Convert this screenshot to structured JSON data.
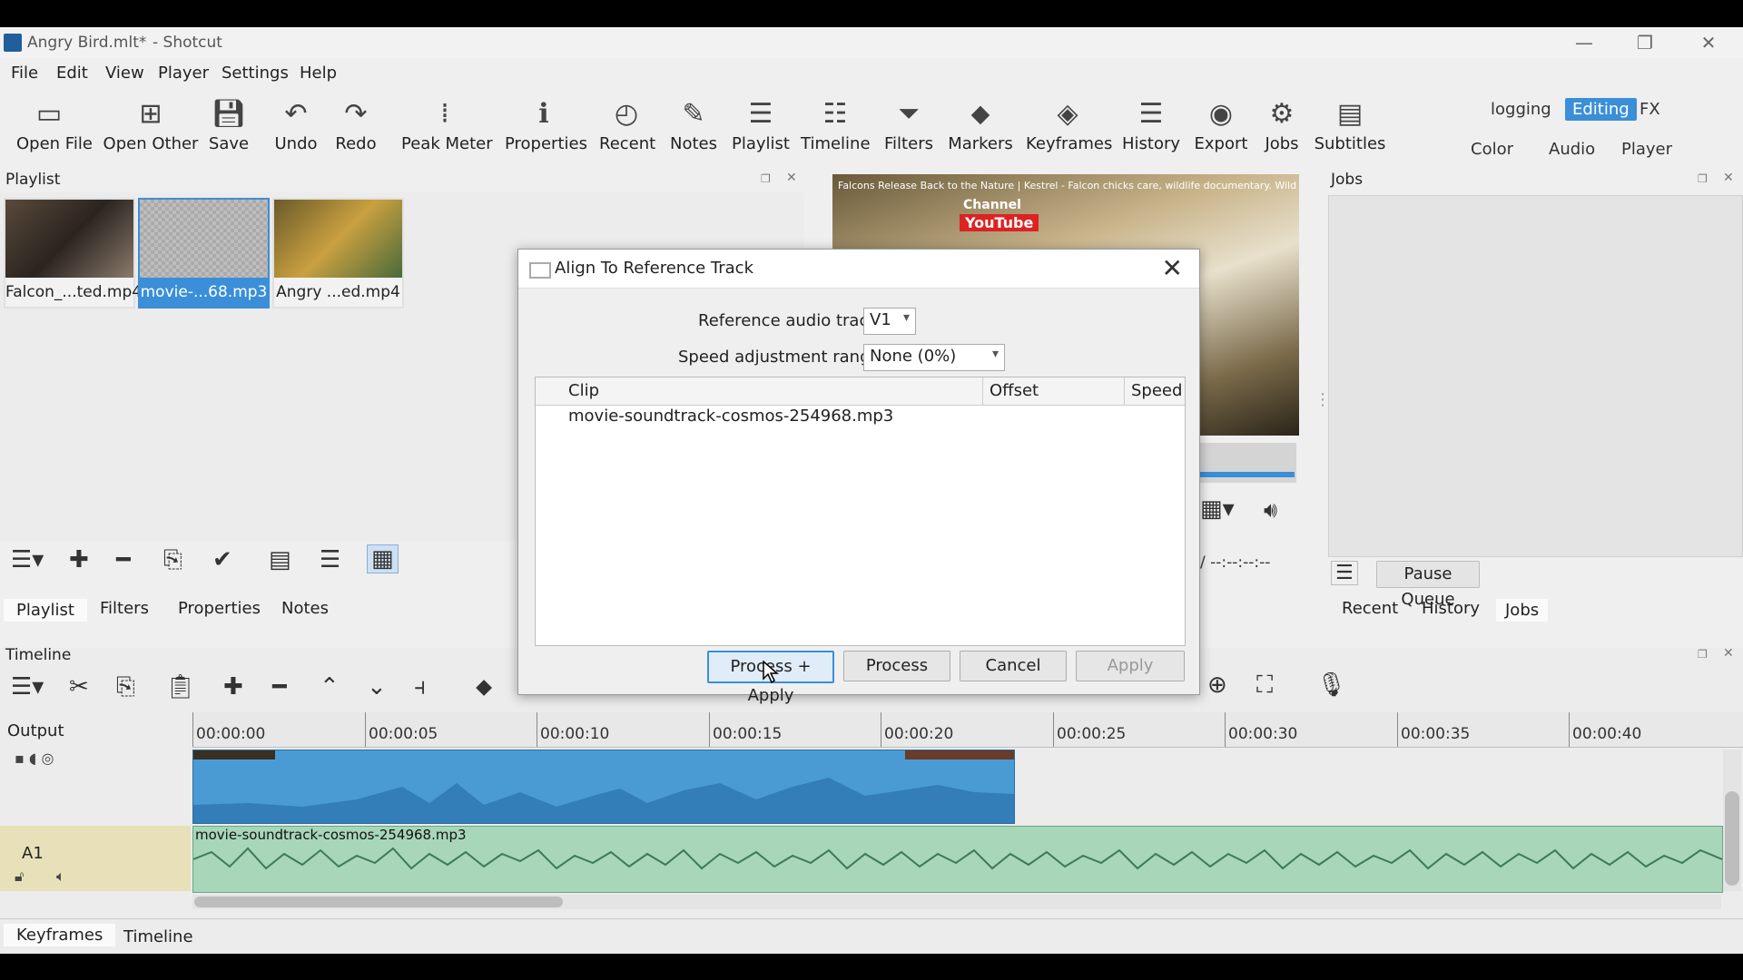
{
  "window": {
    "document_title": "Angry Bird.mlt*",
    "app_separator": "- Shotcut",
    "minimize": "—",
    "restore": "❐",
    "close": "✕"
  },
  "menu": [
    "File",
    "Edit",
    "View",
    "Player",
    "Settings",
    "Help"
  ],
  "toolbar": [
    {
      "label": "Open File",
      "icon": "open-file-icon"
    },
    {
      "label": "Open Other",
      "icon": "open-other-icon"
    },
    {
      "label": "Save",
      "icon": "save-icon"
    },
    {
      "label": "Undo",
      "icon": "undo-icon"
    },
    {
      "label": "Redo",
      "icon": "redo-icon"
    },
    {
      "label": "Peak Meter",
      "icon": "peak-meter-icon"
    },
    {
      "label": "Properties",
      "icon": "properties-icon"
    },
    {
      "label": "Recent",
      "icon": "recent-icon"
    },
    {
      "label": "Notes",
      "icon": "notes-icon"
    },
    {
      "label": "Playlist",
      "icon": "playlist-icon"
    },
    {
      "label": "Timeline",
      "icon": "timeline-icon"
    },
    {
      "label": "Filters",
      "icon": "filters-icon"
    },
    {
      "label": "Markers",
      "icon": "markers-icon"
    },
    {
      "label": "Keyframes",
      "icon": "keyframes-icon"
    },
    {
      "label": "History",
      "icon": "history-icon"
    },
    {
      "label": "Export",
      "icon": "export-icon"
    },
    {
      "label": "Jobs",
      "icon": "jobs-icon"
    },
    {
      "label": "Subtitles",
      "icon": "subtitles-icon"
    }
  ],
  "workspaces": {
    "logging": "logging",
    "editing": "Editing",
    "fx": "FX",
    "color": "Color",
    "audio": "Audio",
    "player": "Player"
  },
  "playlist": {
    "title": "Playlist",
    "items": [
      {
        "caption": "Falcon_...ted.mp4"
      },
      {
        "caption": "movie-...68.mp3"
      },
      {
        "caption": "Angry ...ed.mp4"
      }
    ],
    "tabs": [
      "Playlist",
      "Filters",
      "Properties",
      "Notes"
    ]
  },
  "viewer": {
    "caption": "Falcons Release Back to the Nature | Kestrel - Falcon chicks care, wildlife documentary. Wild birds",
    "channel": "Channel",
    "brand": "YouTube",
    "timecode": "/  --:--:--:--"
  },
  "jobs": {
    "title": "Jobs",
    "pause_queue": "Pause Queue",
    "tabs": [
      "Recent",
      "History",
      "Jobs"
    ]
  },
  "timeline": {
    "title": "Timeline",
    "output_label": "Output",
    "track_a1": "A1",
    "ruler": [
      "00:00:00",
      "00:00:05",
      "00:00:10",
      "00:00:15",
      "00:00:20",
      "00:00:25",
      "00:00:30",
      "00:00:35",
      "00:00:40"
    ],
    "a1_clip": "movie-soundtrack-cosmos-254968.mp3"
  },
  "bottom_tabs": [
    "Keyframes",
    "Timeline"
  ],
  "dialog": {
    "title": "Align To Reference Track",
    "ref_label": "Reference audio track",
    "ref_value": "V1",
    "speed_label": "Speed adjustment range",
    "speed_value": "None (0%)",
    "columns": [
      "Clip",
      "Offset",
      "Speed"
    ],
    "rows": [
      {
        "clip": "movie-soundtrack-cosmos-254968.mp3",
        "offset": "",
        "speed": ""
      }
    ],
    "buttons": {
      "process_apply": "Process + Apply",
      "process": "Process",
      "cancel": "Cancel",
      "apply": "Apply"
    }
  },
  "colors": {
    "accent": "#3a8fd8",
    "clip_video": "#4a9bd3",
    "clip_audio": "#a7d6b8"
  }
}
